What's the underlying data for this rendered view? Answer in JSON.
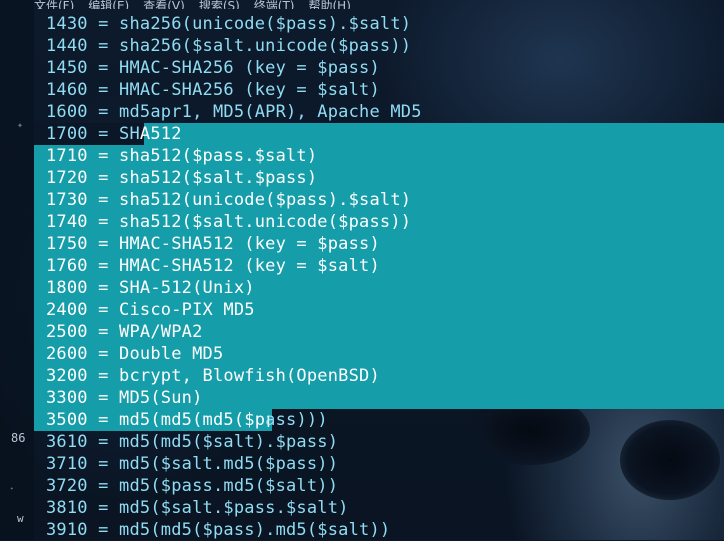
{
  "menubar": {
    "items": [
      "文件(F)",
      "编辑(E)",
      "查看(V)",
      "搜索(S)",
      "终端(T)",
      "帮助(H)"
    ]
  },
  "gutter": {
    "label_86": "86",
    "label_w": "w"
  },
  "terminal": {
    "lines": [
      "1430 = sha256(unicode($pass).$salt)",
      "1440 = sha256($salt.unicode($pass))",
      "1450 = HMAC-SHA256 (key = $pass)",
      "1460 = HMAC-SHA256 (key = $salt)",
      "1600 = md5apr1, MD5(APR), Apache MD5",
      "1700 = SHA512",
      "1710 = sha512($pass.$salt)",
      "1720 = sha512($salt.$pass)",
      "1730 = sha512(unicode($pass).$salt)",
      "1740 = sha512($salt.unicode($pass))",
      "1750 = HMAC-SHA512 (key = $pass)",
      "1760 = HMAC-SHA512 (key = $salt)",
      "1800 = SHA-512(Unix)",
      "2400 = Cisco-PIX MD5",
      "2500 = WPA/WPA2",
      "2600 = Double MD5",
      "3200 = bcrypt, Blowfish(OpenBSD)",
      "3300 = MD5(Sun)",
      "3500 = md5(md5(md5($pass)))",
      "3610 = md5(md5($salt).$pass)",
      "3710 = md5($salt.md5($pass))",
      "3720 = md5($pass.md5($salt))",
      "3810 = md5($salt.$pass.$salt)",
      "3910 = md5(md5($pass).md5($salt))"
    ],
    "line_1700_head": "1700 = SH",
    "line_1700_tail": "A512",
    "line_3500_head": "3500 = md5(md5(md5($p",
    "line_3500_tail": "ass)))"
  },
  "colors": {
    "selection": "#159ea9",
    "text": "#8fdcf3",
    "selected_text": "#ffffff"
  }
}
